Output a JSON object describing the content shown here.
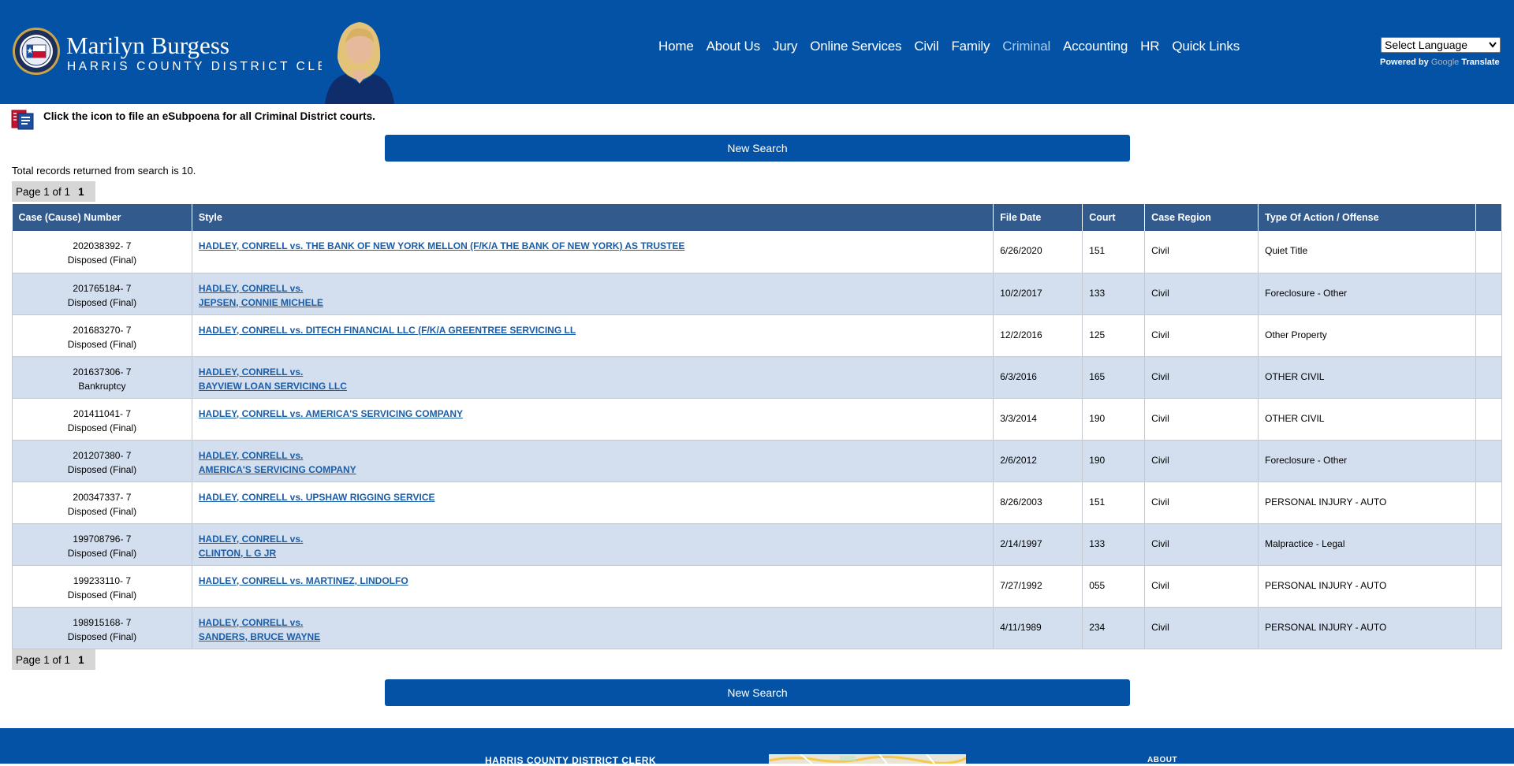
{
  "header": {
    "brand_name": "Marilyn Burgess",
    "brand_subtitle": "HARRIS COUNTY DISTRICT CLERK",
    "nav": [
      "Home",
      "About Us",
      "Jury",
      "Online Services",
      "Civil",
      "Family",
      "Criminal",
      "Accounting",
      "HR",
      "Quick Links"
    ],
    "nav_active": "Criminal",
    "language_select": "Select Language",
    "powered_by": "Powered by",
    "google": "Google",
    "translate": "Translate",
    "colors": {
      "bar": "#0452a6",
      "active_nav": "#a7cdf0"
    }
  },
  "esubpoena": {
    "text": "Click the icon to file an eSubpoena for all Criminal District courts.",
    "icon": "esubpoena-icon"
  },
  "search": {
    "new_search_label": "New Search",
    "total_text": "Total records returned from search is 10.",
    "pager_text": "Page 1 of 1",
    "pager_current": "1"
  },
  "table": {
    "headers": [
      "Case (Cause) Number",
      "Style",
      "File Date",
      "Court",
      "Case Region",
      "Type Of Action / Offense"
    ],
    "rows": [
      {
        "case": "202038392- 7",
        "status": "Disposed (Final)",
        "style1": "HADLEY, CONRELL vs. THE BANK OF NEW YORK MELLON (F/K/A THE BANK OF NEW YORK) AS TRUSTEE",
        "style2": "",
        "date": "6/26/2020",
        "court": "151",
        "region": "Civil",
        "type": "Quiet Title"
      },
      {
        "case": "201765184- 7",
        "status": "Disposed (Final)",
        "style1": "HADLEY, CONRELL vs.",
        "style2": "JEPSEN, CONNIE MICHELE",
        "date": "10/2/2017",
        "court": "133",
        "region": "Civil",
        "type": "Foreclosure - Other"
      },
      {
        "case": "201683270- 7",
        "status": "Disposed (Final)",
        "style1": "HADLEY, CONRELL vs. DITECH FINANCIAL LLC (F/K/A GREENTREE SERVICING LL",
        "style2": "",
        "date": "12/2/2016",
        "court": "125",
        "region": "Civil",
        "type": "Other Property"
      },
      {
        "case": "201637306- 7",
        "status": "Bankruptcy",
        "style1": "HADLEY, CONRELL vs.",
        "style2": "BAYVIEW LOAN SERVICING LLC",
        "date": "6/3/2016",
        "court": "165",
        "region": "Civil",
        "type": "OTHER CIVIL"
      },
      {
        "case": "201411041- 7",
        "status": "Disposed (Final)",
        "style1": "HADLEY, CONRELL vs. AMERICA'S SERVICING COMPANY",
        "style2": "",
        "date": "3/3/2014",
        "court": "190",
        "region": "Civil",
        "type": "OTHER CIVIL"
      },
      {
        "case": "201207380- 7",
        "status": "Disposed (Final)",
        "style1": "HADLEY, CONRELL vs.",
        "style2": "AMERICA'S SERVICING COMPANY",
        "date": "2/6/2012",
        "court": "190",
        "region": "Civil",
        "type": "Foreclosure - Other"
      },
      {
        "case": "200347337- 7",
        "status": "Disposed (Final)",
        "style1": "HADLEY, CONRELL  vs. UPSHAW RIGGING SERVICE",
        "style2": "",
        "date": "8/26/2003",
        "court": "151",
        "region": "Civil",
        "type": "PERSONAL INJURY - AUTO"
      },
      {
        "case": "199708796- 7",
        "status": "Disposed (Final)",
        "style1": "HADLEY, CONRELL  vs.",
        "style2": "CLINTON, L G JR",
        "date": "2/14/1997",
        "court": "133",
        "region": "Civil",
        "type": "Malpractice - Legal"
      },
      {
        "case": "199233110- 7",
        "status": "Disposed (Final)",
        "style1": "HADLEY, CONRELL  vs. MARTINEZ, LINDOLFO",
        "style2": "",
        "date": "7/27/1992",
        "court": "055",
        "region": "Civil",
        "type": "PERSONAL INJURY - AUTO"
      },
      {
        "case": "198915168- 7",
        "status": "Disposed (Final)",
        "style1": "HADLEY, CONRELL  vs.",
        "style2": "SANDERS, BRUCE WAYNE",
        "date": "4/11/1989",
        "court": "234",
        "region": "Civil",
        "type": "PERSONAL INJURY - AUTO"
      }
    ]
  },
  "footer": {
    "title": "HARRIS COUNTY DISTRICT CLERK",
    "about": "ABOUT"
  }
}
